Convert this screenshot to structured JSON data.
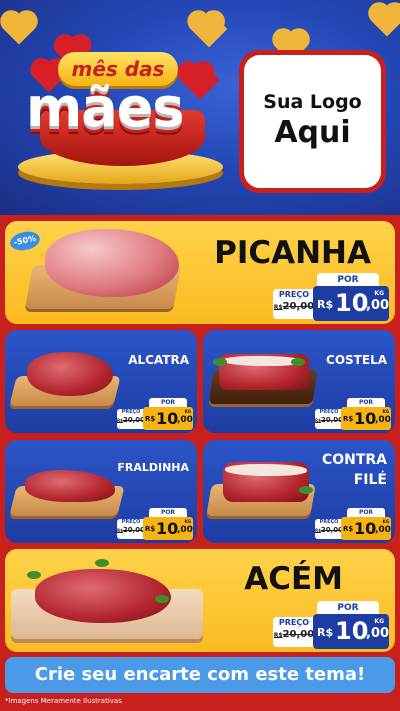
{
  "header": {
    "campaign_top": "mês das",
    "campaign_bottom": "mães",
    "logo_line1": "Sua Logo",
    "logo_line2": "Aqui"
  },
  "featured": [
    {
      "name": "PICANHA",
      "badge": "-50%",
      "preco_label": "PREÇO",
      "old_price_currency": "R$",
      "old_price": "20,00",
      "por_label": "POR",
      "currency": "R$",
      "price_int": "10",
      "price_dec": ",00",
      "unit": "KG"
    },
    {
      "name": "ACÉM",
      "preco_label": "PREÇO",
      "old_price_currency": "R$",
      "old_price": "20,00",
      "por_label": "POR",
      "currency": "R$",
      "price_int": "10",
      "price_dec": ",00",
      "unit": "KG"
    }
  ],
  "items": [
    {
      "name": "ALCATRA",
      "preco_label": "PREÇO",
      "old_price_currency": "R$",
      "old_price": "20,00",
      "por_label": "POR",
      "currency": "R$",
      "price_int": "10",
      "price_dec": ",00",
      "unit": "KG"
    },
    {
      "name": "COSTELA",
      "preco_label": "PREÇO",
      "old_price_currency": "R$",
      "old_price": "20,00",
      "por_label": "POR",
      "currency": "R$",
      "price_int": "10",
      "price_dec": ",00",
      "unit": "KG"
    },
    {
      "name": "FRALDINHA",
      "preco_label": "PREÇO",
      "old_price_currency": "R$",
      "old_price": "20,00",
      "por_label": "POR",
      "currency": "R$",
      "price_int": "10",
      "price_dec": ",00",
      "unit": "KG"
    },
    {
      "name_line1": "CONTRA",
      "name_line2": "FILÉ",
      "preco_label": "PREÇO",
      "old_price_currency": "R$",
      "old_price": "20,00",
      "por_label": "POR",
      "currency": "R$",
      "price_int": "10",
      "price_dec": ",00",
      "unit": "KG"
    }
  ],
  "cta_text": "Crie seu encarte com este tema!",
  "footnote": "*Imagens Meramente Ilustrativas",
  "colors": {
    "background_red": "#c8201c",
    "header_blue": "#2447b6",
    "card_yellow": "#fbbb21",
    "card_blue": "#1e3da3",
    "cta_blue": "#4b9ae8"
  }
}
